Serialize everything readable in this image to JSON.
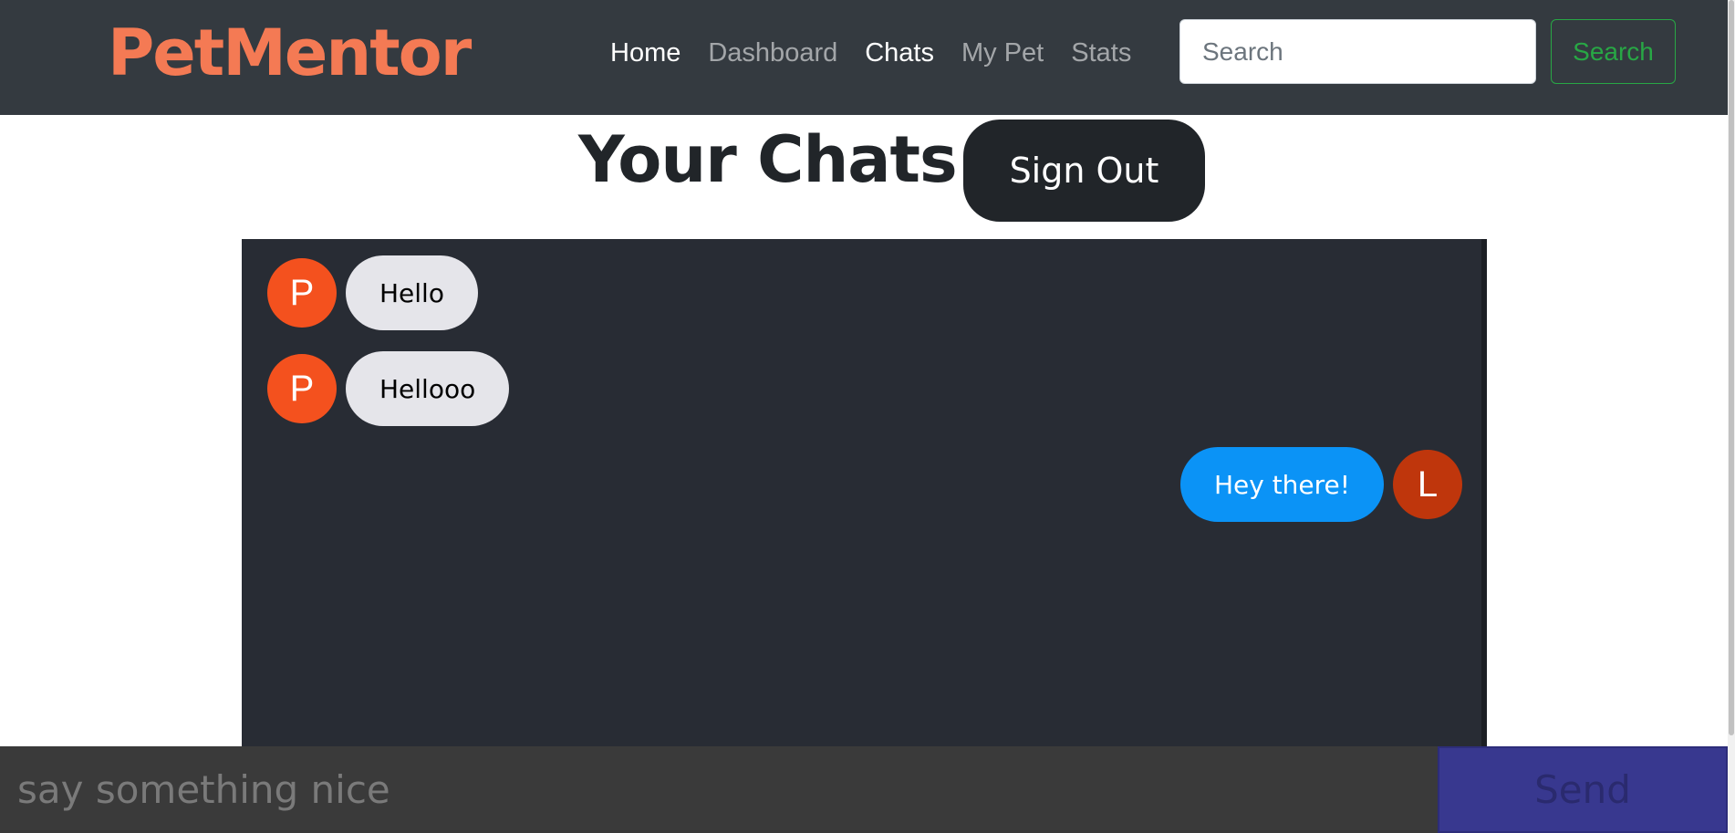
{
  "navbar": {
    "brand": "PetMentor",
    "links": [
      {
        "label": "Home",
        "active": true
      },
      {
        "label": "Dashboard",
        "active": false
      },
      {
        "label": "Chats",
        "active": true
      },
      {
        "label": "My Pet",
        "active": false
      },
      {
        "label": "Stats",
        "active": false
      }
    ],
    "search_placeholder": "Search",
    "search_button": "Search"
  },
  "header": {
    "title": "Your Chats",
    "sign_out": "Sign Out"
  },
  "messages": [
    {
      "sender_initial": "P",
      "text": "Hello",
      "direction": "received",
      "avatar_color": "#f4511e"
    },
    {
      "sender_initial": "P",
      "text": "Hellooo",
      "direction": "received",
      "avatar_color": "#f4511e"
    },
    {
      "sender_initial": "L",
      "text": "Hey there!",
      "direction": "sent",
      "avatar_color": "#bf360c"
    }
  ],
  "composer": {
    "placeholder": "say something nice",
    "send_label": "Send"
  },
  "colors": {
    "navbar": "#343a40",
    "brand": "#f47a54",
    "chat_background": "#282c34",
    "received_bubble": "#e5e5ea",
    "sent_bubble": "#0b93f6",
    "send_button": "#38388f",
    "search_button": "#28a745"
  }
}
